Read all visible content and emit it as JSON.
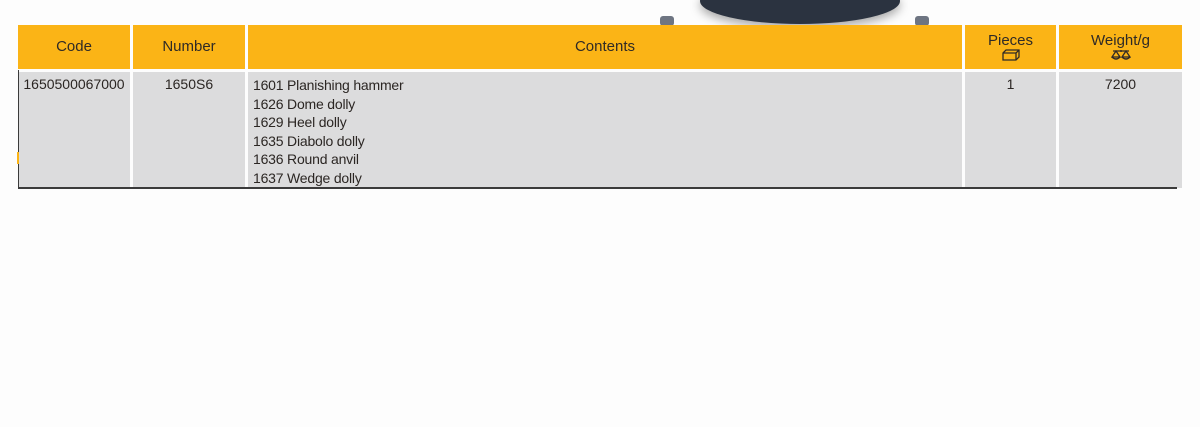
{
  "table": {
    "headers": {
      "code": "Code",
      "number": "Number",
      "contents": "Contents",
      "pieces": "Pieces",
      "pieces_icon": "box-icon",
      "weight": "Weight/g",
      "weight_icon": "scale-icon"
    },
    "rows": [
      {
        "code": "1650500067000",
        "number": "1650S6",
        "contents": [
          "1601 Planishing hammer",
          "1626 Dome dolly",
          "1629 Heel dolly",
          "1635 Diabolo dolly",
          "1636 Round anvil",
          "1637 Wedge dolly"
        ],
        "pieces": "1",
        "weight": "7200"
      }
    ]
  },
  "colors": {
    "header_bg": "#fbb416",
    "row_bg": "#dcdcdd",
    "page_bg": "#fdfdfd",
    "text": "#2f2a26"
  }
}
